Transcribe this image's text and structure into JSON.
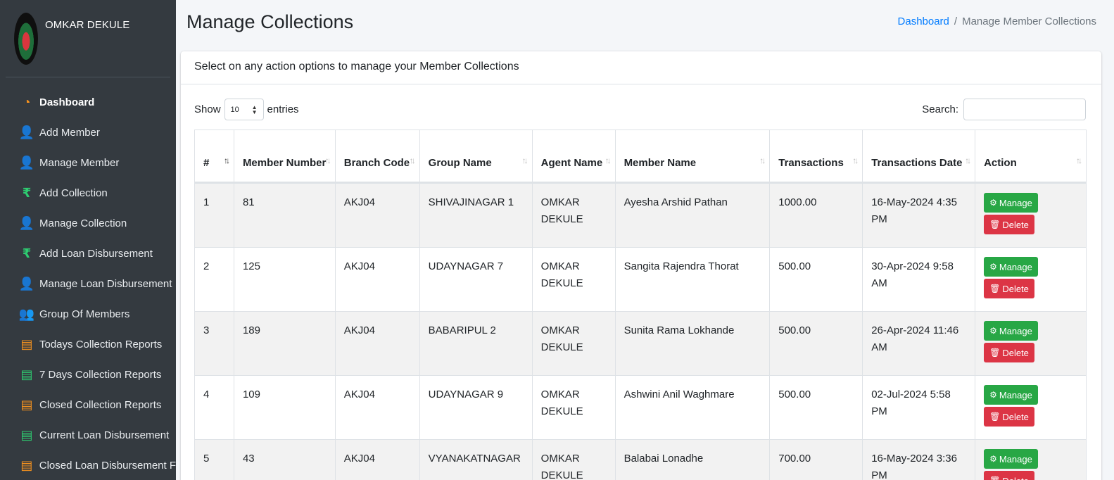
{
  "user": {
    "name": "OMKAR DEKULE"
  },
  "sidebar": {
    "items": [
      {
        "label": "Dashboard",
        "icon": "tachometer-icon",
        "glyph": "◔",
        "color": "orange"
      },
      {
        "label": "Add Member",
        "icon": "user-plus-icon",
        "glyph": "👤",
        "color": "green"
      },
      {
        "label": "Manage Member",
        "icon": "user-cog-icon",
        "glyph": "👤",
        "color": "orange"
      },
      {
        "label": "Add Collection",
        "icon": "rupee-icon",
        "glyph": "₹",
        "color": "green"
      },
      {
        "label": "Manage Collection",
        "icon": "user-cog-icon",
        "glyph": "👤",
        "color": "orange"
      },
      {
        "label": "Add Loan Disbursement",
        "icon": "rupee-icon",
        "glyph": "₹",
        "color": "green"
      },
      {
        "label": "Manage Loan Disbursement",
        "icon": "user-cog-icon",
        "glyph": "👤",
        "color": "orange"
      },
      {
        "label": "Group Of Members",
        "icon": "users-icon",
        "glyph": "👥",
        "color": "green"
      },
      {
        "label": "Todays Collection Reports",
        "icon": "file-icon",
        "glyph": "▤",
        "color": "orange"
      },
      {
        "label": "7 Days Collection Reports",
        "icon": "file-icon",
        "glyph": "▤",
        "color": "green"
      },
      {
        "label": "Closed Collection Reports",
        "icon": "file-icon",
        "glyph": "▤",
        "color": "orange"
      },
      {
        "label": "Current Loan Disbursement",
        "icon": "file-icon",
        "glyph": "▤",
        "color": "green"
      },
      {
        "label": "Closed Loan Disbursement F",
        "icon": "file-icon",
        "glyph": "▤",
        "color": "orange"
      }
    ]
  },
  "header": {
    "title": "Manage Collections",
    "breadcrumb_home": "Dashboard",
    "breadcrumb_sep": "/",
    "breadcrumb_current": "Manage Member Collections"
  },
  "card": {
    "header": "Select on any action options to manage your Member Collections",
    "show_label": "Show",
    "entries_value": "10",
    "entries_label": "entries",
    "search_label": "Search:"
  },
  "table": {
    "columns": [
      "#",
      "Member Number",
      "Branch Code",
      "Group Name",
      "Agent Name",
      "Member Name",
      "Transactions",
      "Transactions Date",
      "Action"
    ],
    "rows": [
      [
        "1",
        "81",
        "AKJ04",
        "SHIVAJINAGAR 1",
        "OMKAR DEKULE",
        "Ayesha Arshid Pathan",
        "1000.00",
        "16-May-2024 4:35 PM"
      ],
      [
        "2",
        "125",
        "AKJ04",
        "UDAYNAGAR 7",
        "OMKAR DEKULE",
        "Sangita Rajendra Thorat",
        "500.00",
        "30-Apr-2024 9:58 AM"
      ],
      [
        "3",
        "189",
        "AKJ04",
        "BABARIPUL 2",
        "OMKAR DEKULE",
        "Sunita Rama Lokhande",
        "500.00",
        "26-Apr-2024 11:46 AM"
      ],
      [
        "4",
        "109",
        "AKJ04",
        "UDAYNAGAR 9",
        "OMKAR DEKULE",
        "Ashwini Anil Waghmare",
        "500.00",
        "02-Jul-2024 5:58 PM"
      ],
      [
        "5",
        "43",
        "AKJ04",
        "VYANAKATNAGAR",
        "OMKAR DEKULE",
        "Balabai Lonadhe",
        "700.00",
        "16-May-2024 3:36 PM"
      ]
    ],
    "manage_label": "Manage",
    "delete_label": "Delete"
  }
}
